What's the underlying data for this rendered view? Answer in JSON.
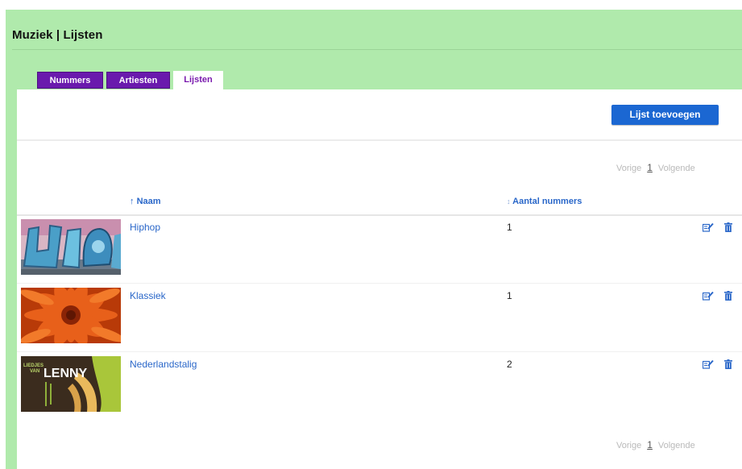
{
  "page": {
    "title": "Muziek | Lijsten"
  },
  "tabs": [
    {
      "label": "Nummers",
      "active": false
    },
    {
      "label": "Artiesten",
      "active": false
    },
    {
      "label": "Lijsten",
      "active": true
    }
  ],
  "toolbar": {
    "add_label": "Lijst toevoegen"
  },
  "pager": {
    "prev_label": "Vorige",
    "current_page": "1",
    "next_label": "Volgende"
  },
  "table": {
    "columns": [
      {
        "sort_glyph": "↑",
        "label": "Naam"
      },
      {
        "sort_glyph": "↕",
        "label": "Aantal nummers"
      }
    ],
    "rows": [
      {
        "name": "Hiphop",
        "count": "1",
        "thumbnail": "graffiti-image"
      },
      {
        "name": "Klassiek",
        "count": "1",
        "thumbnail": "orange-flower-image"
      },
      {
        "name": "Nederlandstalig",
        "count": "2",
        "thumbnail": "lenny-album-cover-image",
        "thumbnail_text": [
          "LIEDJES",
          "VAN",
          "LENNY"
        ]
      }
    ],
    "row_actions": [
      {
        "icon": "edit-icon",
        "color": "#2a67c9"
      },
      {
        "icon": "trash-icon",
        "color": "#2a67c9"
      }
    ]
  },
  "colors": {
    "frame": "#b0eaac",
    "tab": "#6a1aad",
    "button": "#1b67d2",
    "link": "#2a67c9"
  }
}
